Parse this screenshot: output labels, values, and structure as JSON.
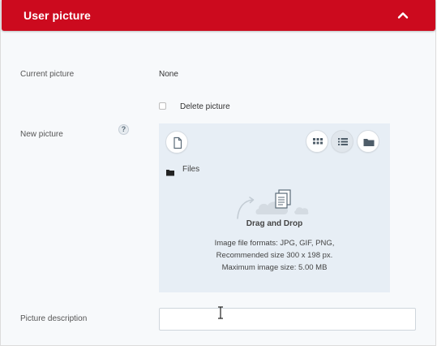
{
  "header": {
    "title": "User picture",
    "color": "#cc0a1e",
    "collapse_icon": "chevron-up-icon"
  },
  "current_picture": {
    "label": "Current picture",
    "value": "None"
  },
  "delete_picture": {
    "label": "Delete picture",
    "checked": false
  },
  "new_picture": {
    "label": "New picture",
    "help": "?"
  },
  "uploader": {
    "add_file_icon": "file-icon",
    "view_buttons": [
      "grid-view-icon",
      "list-view-icon",
      "folder-icon"
    ],
    "active_view": "list-view-icon",
    "path_label": "Files",
    "dnd_title": "Drag and Drop",
    "info_formats": "Image file formats: JPG, GIF, PNG,",
    "info_size": "Recommended size 300 x 198 px.",
    "info_max": "Maximum image size: 5.00 MB"
  },
  "picture_description": {
    "label": "Picture description",
    "value": "",
    "placeholder": ""
  }
}
